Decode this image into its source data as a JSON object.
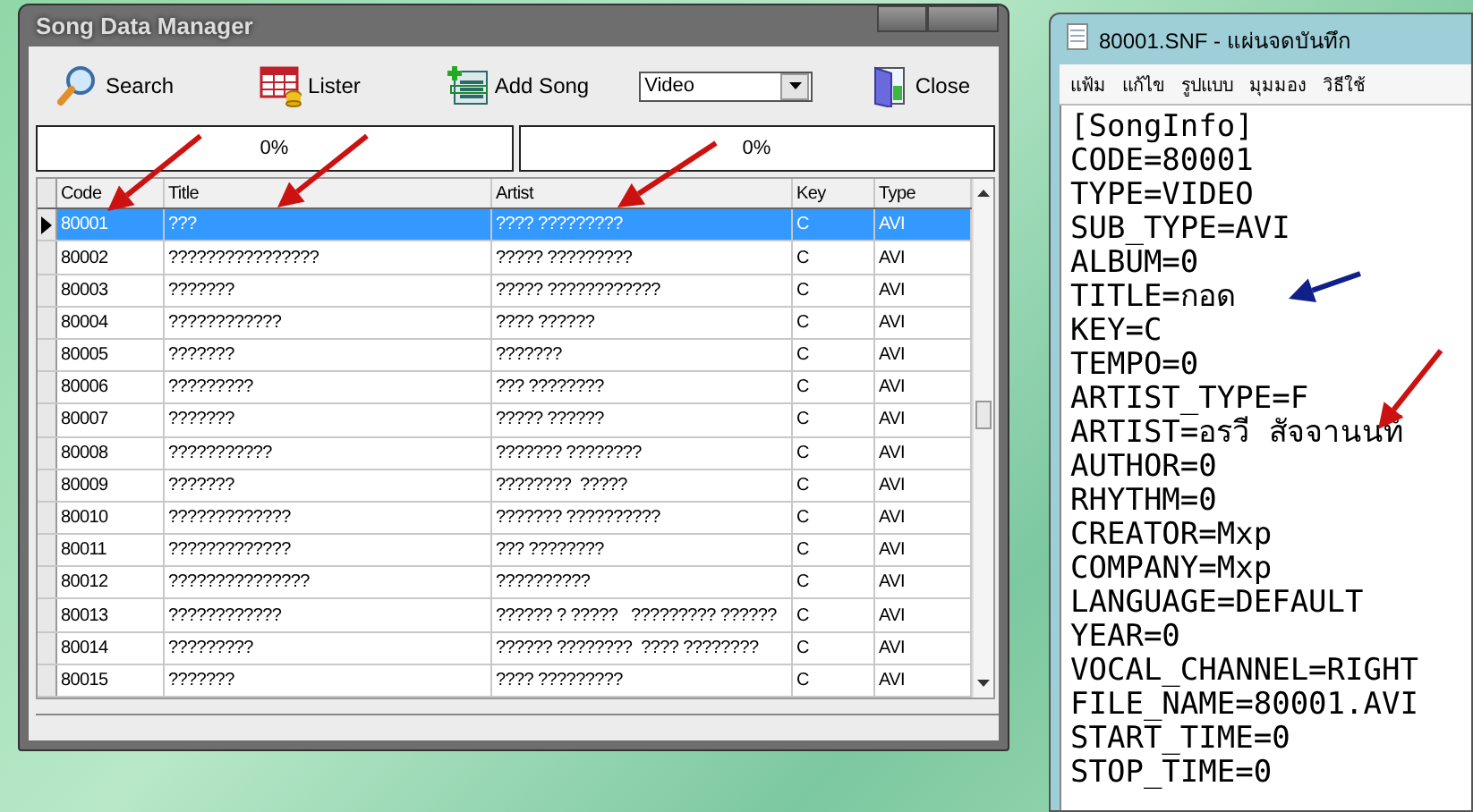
{
  "manager": {
    "title": "Song Data Manager",
    "toolbar": [
      {
        "kind": "search",
        "label": "Search"
      },
      {
        "kind": "lister",
        "label": "Lister"
      },
      {
        "kind": "add",
        "label": "Add Song"
      },
      {
        "kind": "select",
        "value": "Video"
      },
      {
        "kind": "close",
        "label": "Close"
      }
    ],
    "progress": [
      {
        "label": "0%",
        "level": 0
      },
      {
        "label": "0%",
        "level": 0
      }
    ],
    "table": {
      "columns": [
        "Code",
        "Title",
        "Artist",
        "Key",
        "Type"
      ],
      "rows": [
        {
          "selected": true,
          "cells": [
            "80001",
            "???",
            "???? ?????????",
            "C",
            "AVI"
          ]
        },
        {
          "selected": false,
          "cells": [
            "80002",
            "????????????????",
            "????? ?????????",
            "C",
            "AVI"
          ]
        },
        {
          "selected": false,
          "cells": [
            "80003",
            "???????",
            "????? ????????????",
            "C",
            "AVI"
          ]
        },
        {
          "selected": false,
          "cells": [
            "80004",
            "????????????",
            "???? ??????",
            "C",
            "AVI"
          ]
        },
        {
          "selected": false,
          "cells": [
            "80005",
            "???????",
            "???????",
            "C",
            "AVI"
          ]
        },
        {
          "selected": false,
          "cells": [
            "80006",
            "?????????",
            "??? ????????",
            "C",
            "AVI"
          ]
        },
        {
          "selected": false,
          "cells": [
            "80007",
            "???????",
            "????? ??????",
            "C",
            "AVI"
          ]
        },
        {
          "selected": false,
          "cells": [
            "80008",
            "???????????",
            "??????? ????????",
            "C",
            "AVI"
          ]
        },
        {
          "selected": false,
          "cells": [
            "80009",
            "???????",
            "????????  ?????",
            "C",
            "AVI"
          ]
        },
        {
          "selected": false,
          "cells": [
            "80010",
            "?????????????",
            "??????? ??????????",
            "C",
            "AVI"
          ]
        },
        {
          "selected": false,
          "cells": [
            "80011",
            "?????????????",
            "??? ????????",
            "C",
            "AVI"
          ]
        },
        {
          "selected": false,
          "cells": [
            "80012",
            "???????????????",
            "??????????",
            "C",
            "AVI"
          ]
        },
        {
          "selected": false,
          "cells": [
            "80013",
            "????????????",
            "?????? ? ?????   ????????? ??????",
            "C",
            "AVI"
          ]
        },
        {
          "selected": false,
          "cells": [
            "80014",
            "?????????",
            "?????? ????????  ???? ????????",
            "C",
            "AVI"
          ]
        },
        {
          "selected": false,
          "cells": [
            "80015",
            "???????",
            "???? ?????????",
            "C",
            "AVI"
          ]
        }
      ]
    }
  },
  "notepad": {
    "title": "80001.SNF - แผ่นจดบันทึก",
    "menu": [
      "แฟ้ม",
      "แก้ไข",
      "รูปแบบ",
      "มุมมอง",
      "วิธีใช้"
    ],
    "lines": [
      "[SongInfo]",
      "CODE=80001",
      "TYPE=VIDEO",
      "SUB_TYPE=AVI",
      "ALBUM=0",
      "TITLE=กอด",
      "KEY=C",
      "TEMPO=0",
      "ARTIST_TYPE=F",
      "ARTIST=อรวี สัจจานนท์",
      "AUTHOR=0",
      "RHYTHM=0",
      "CREATOR=Mxp",
      "COMPANY=Mxp",
      "LANGUAGE=DEFAULT",
      "YEAR=0",
      "VOCAL_CHANNEL=RIGHT",
      "FILE_NAME=80001.AVI",
      "START_TIME=0",
      "STOP_TIME=0"
    ]
  },
  "annotations": [
    {
      "color": "#cc1111"
    },
    {
      "color": "#cc1111"
    },
    {
      "color": "#cc1111"
    },
    {
      "color": "#10208a"
    },
    {
      "color": "#cc1111"
    }
  ]
}
